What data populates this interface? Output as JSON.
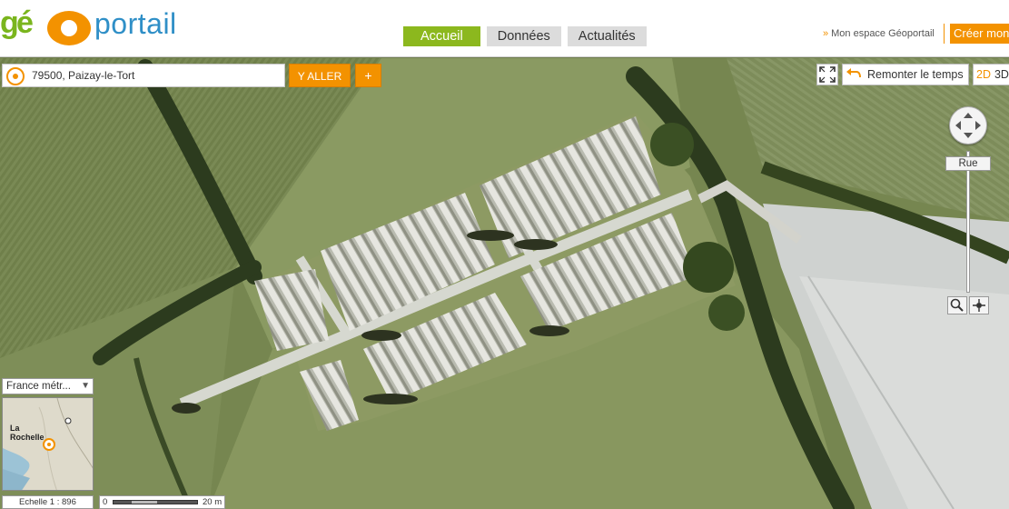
{
  "logo": {
    "part1": "g",
    "part2": "é",
    "part3": "portail"
  },
  "nav": {
    "tabs": [
      {
        "label": "Accueil"
      },
      {
        "label": "Données"
      },
      {
        "label": "Actualités"
      }
    ]
  },
  "account": {
    "espace_label": "Mon espace Géoportail",
    "creer_label": "Créer mon"
  },
  "search": {
    "value": "79500, Paizay-le-Tort",
    "go_label": "Y ALLER",
    "plus_label": "+"
  },
  "tools": {
    "remonter_label": "Remonter le temps",
    "mode_2d": "2D",
    "mode_3d": "3D",
    "rue_label": "Rue"
  },
  "overview": {
    "territory": "France métr...",
    "city_label": "La Rochelle"
  },
  "scale": {
    "label": "Echelle 1 : 896",
    "zero": "0",
    "length": "20 m"
  },
  "colors": {
    "brand_orange": "#f39200",
    "brand_green": "#8cb81e",
    "brand_blue": "#2f8fc7"
  }
}
